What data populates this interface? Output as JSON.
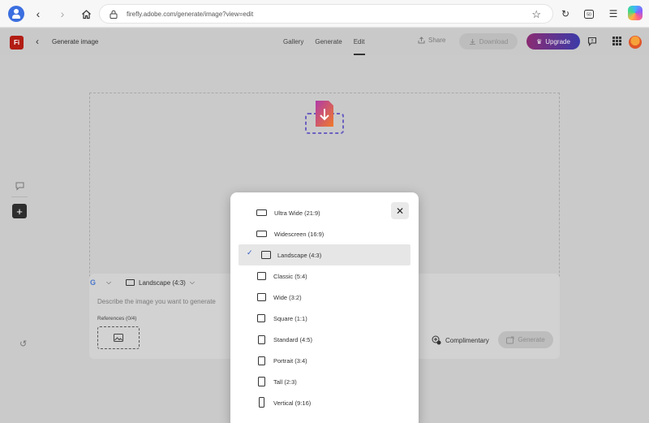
{
  "browser": {
    "url": "firefly.adobe.com/generate/image?view=edit",
    "back_icon": "chevron-left-icon",
    "forward_icon": "chevron-right-icon"
  },
  "header": {
    "logo": "Fi",
    "title": "Generate image",
    "tabs": [
      "Gallery",
      "Generate",
      "Edit"
    ],
    "active_tab": "Edit",
    "share_label": "Share",
    "download_label": "Download",
    "upgrade_label": "Upgrade"
  },
  "prompt": {
    "model_icon": "G",
    "aspect_label": "Landscape (4:3)",
    "placeholder": "Describe the image you want to generate",
    "references_label": "References (0/4)",
    "complimentary_label": "Complimentary",
    "generate_label": "Generate"
  },
  "dropdown": {
    "items": [
      {
        "label": "Ultra Wide (21:9)",
        "shape": "ultra-wide",
        "selected": false
      },
      {
        "label": "Widescreen (16:9)",
        "shape": "widescreen",
        "selected": false
      },
      {
        "label": "Landscape (4:3)",
        "shape": "landscape",
        "selected": true
      },
      {
        "label": "Classic (5:4)",
        "shape": "classic",
        "selected": false
      },
      {
        "label": "Wide (3:2)",
        "shape": "wide",
        "selected": false
      },
      {
        "label": "Square (1:1)",
        "shape": "square",
        "selected": false
      },
      {
        "label": "Standard (4:5)",
        "shape": "standard",
        "selected": false
      },
      {
        "label": "Portrait (3:4)",
        "shape": "portrait",
        "selected": false
      },
      {
        "label": "Tall (2:3)",
        "shape": "tall",
        "selected": false
      },
      {
        "label": "Vertical (9:16)",
        "shape": "vertical",
        "selected": false
      }
    ]
  },
  "colors": {
    "accent": "#2a58c7",
    "upgrade_gradient_start": "#8a2c73",
    "upgrade_gradient_end": "#3b3aa8",
    "logo_red": "#b21d14"
  }
}
